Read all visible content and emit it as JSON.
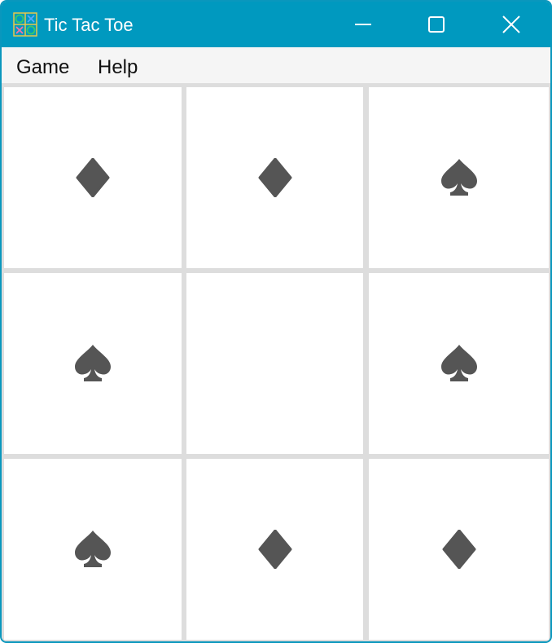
{
  "window": {
    "title": "Tic Tac Toe",
    "app_icon": "tic-tac-toe-icon",
    "controls": {
      "minimize": "minimize-icon",
      "maximize": "maximize-icon",
      "close": "close-icon"
    },
    "colors": {
      "titlebar": "#0099bf",
      "menubar": "#f5f5f5",
      "grid_lines": "#dddddd",
      "cell": "#ffffff",
      "piece": "#555555"
    }
  },
  "menu": {
    "items": [
      "Game",
      "Help"
    ]
  },
  "board": {
    "cells": [
      {
        "row": 1,
        "col": 1,
        "piece": "diamond"
      },
      {
        "row": 1,
        "col": 2,
        "piece": "diamond"
      },
      {
        "row": 1,
        "col": 3,
        "piece": "spade"
      },
      {
        "row": 2,
        "col": 1,
        "piece": "spade"
      },
      {
        "row": 2,
        "col": 2,
        "piece": ""
      },
      {
        "row": 2,
        "col": 3,
        "piece": "spade"
      },
      {
        "row": 3,
        "col": 1,
        "piece": "spade"
      },
      {
        "row": 3,
        "col": 2,
        "piece": "diamond"
      },
      {
        "row": 3,
        "col": 3,
        "piece": "diamond"
      }
    ]
  }
}
